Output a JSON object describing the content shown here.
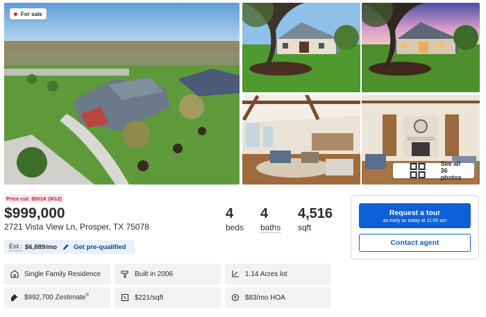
{
  "gallery": {
    "badge": "For sale",
    "see_all_label": "See all 36 photos",
    "photos": [
      {
        "subject": "aerial-view"
      },
      {
        "subject": "front-exterior-day"
      },
      {
        "subject": "front-exterior-dusk"
      },
      {
        "subject": "living-room-beams"
      },
      {
        "subject": "living-room-fireplace"
      }
    ]
  },
  "listing": {
    "price_cut": "Price cut: $501K (6/12)",
    "price": "$999,000",
    "address": "2721 Vista View Ln, Prosper, TX 75078",
    "beds": {
      "value": "4",
      "label": "beds"
    },
    "baths": {
      "value": "4",
      "label": "baths"
    },
    "sqft": {
      "value": "4,516",
      "label": "sqft"
    },
    "estimate": {
      "label": "Est.:",
      "value": "$6,889/mo",
      "link": "Get pre-qualified"
    }
  },
  "facts": [
    {
      "icon": "house-icon",
      "text": "Single Family Residence"
    },
    {
      "icon": "hammer-icon",
      "text": "Built in 2006"
    },
    {
      "icon": "lot-icon",
      "text": "1.14 Acres lot"
    },
    {
      "icon": "zestimate-icon",
      "text": "$992,700 Zestimate",
      "sup": "®"
    },
    {
      "icon": "price-tag-icon",
      "text": "$221/sqft"
    },
    {
      "icon": "hoa-icon",
      "text": "$83/mo HOA"
    }
  ],
  "actions": {
    "tour_title": "Request a tour",
    "tour_subtitle": "as early as today at 11:00 am",
    "contact_label": "Contact agent"
  },
  "colors": {
    "accent": "#0f60d6",
    "price_cut_bg": "#fde9ec",
    "price_cut_text": "#c2132e",
    "fact_bg": "#f2f2f4",
    "estimate_bg": "#e8f0fb"
  }
}
